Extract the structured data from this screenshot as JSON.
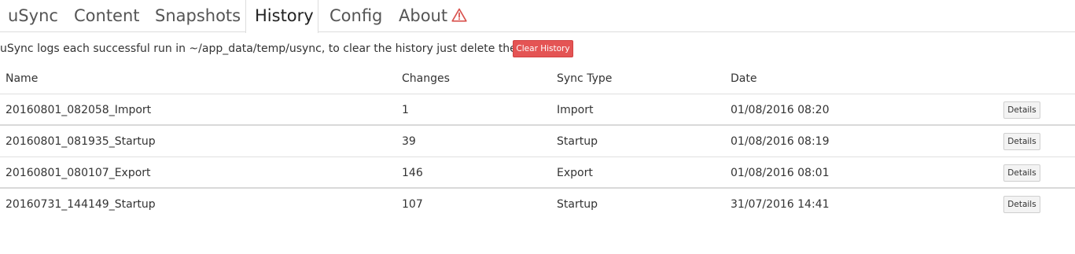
{
  "tabs": [
    {
      "label": "uSync",
      "active": false
    },
    {
      "label": "Content",
      "active": false
    },
    {
      "label": "Snapshots",
      "active": false
    },
    {
      "label": "History",
      "active": true
    },
    {
      "label": "Config",
      "active": false
    },
    {
      "label": "About",
      "active": false,
      "icon": "warning-icon"
    }
  ],
  "intro": {
    "text": "uSync logs each successful run in ~/app_data/temp/usync, to clear the history just delete these files.",
    "clear_button_label": "Clear History"
  },
  "table": {
    "headers": {
      "name": "Name",
      "changes": "Changes",
      "sync_type": "Sync Type",
      "date": "Date"
    },
    "rows": [
      {
        "name": "20160801_082058_Import",
        "changes": "1",
        "sync_type": "Import",
        "date": "01/08/2016 08:20",
        "action": "Details"
      },
      {
        "name": "20160801_081935_Startup",
        "changes": "39",
        "sync_type": "Startup",
        "date": "01/08/2016 08:19",
        "action": "Details"
      },
      {
        "name": "20160801_080107_Export",
        "changes": "146",
        "sync_type": "Export",
        "date": "01/08/2016 08:01",
        "action": "Details"
      },
      {
        "name": "20160731_144149_Startup",
        "changes": "107",
        "sync_type": "Startup",
        "date": "31/07/2016 14:41",
        "action": "Details"
      }
    ]
  },
  "colors": {
    "danger": "#e45454",
    "warning_icon": "#d9534f"
  }
}
